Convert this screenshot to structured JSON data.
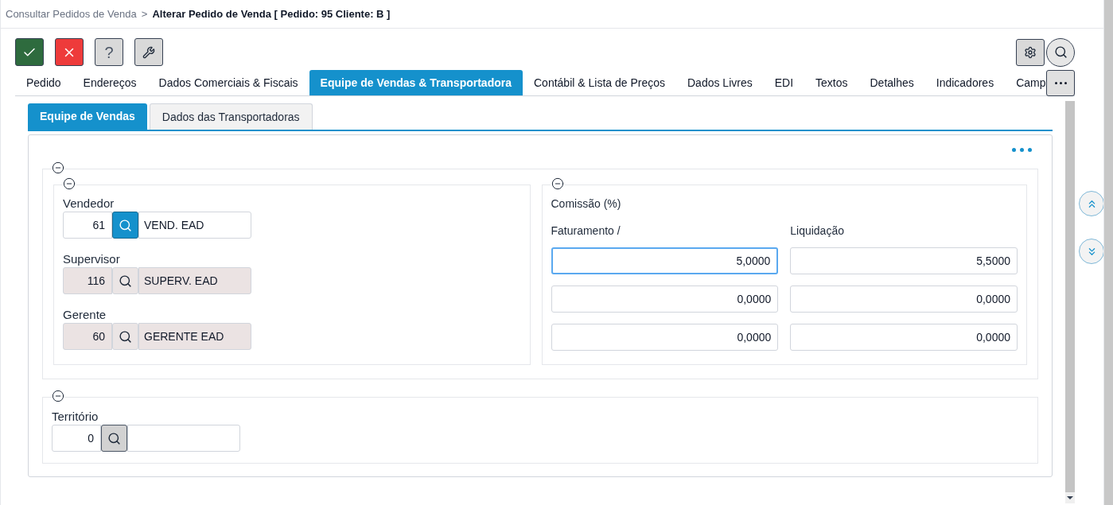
{
  "breadcrumb": {
    "parent": "Consultar Pedidos de Venda",
    "separator": ">",
    "current": "Alterar Pedido de Venda [ Pedido: 95 Cliente: B ]"
  },
  "tabs": [
    {
      "label": "Pedido",
      "selected": false
    },
    {
      "label": "Endereços",
      "selected": false
    },
    {
      "label": "Dados Comerciais & Fiscais",
      "selected": false
    },
    {
      "label": "Equipe de Vendas & Transportadora",
      "selected": true
    },
    {
      "label": "Contábil & Lista de Preços",
      "selected": false
    },
    {
      "label": "Dados Livres",
      "selected": false
    },
    {
      "label": "EDI",
      "selected": false
    },
    {
      "label": "Textos",
      "selected": false
    },
    {
      "label": "Detalhes",
      "selected": false
    },
    {
      "label": "Indicadores",
      "selected": false
    },
    {
      "label": "Camp",
      "selected": false
    }
  ],
  "subtabs": [
    {
      "label": "Equipe de Vendas",
      "selected": true
    },
    {
      "label": "Dados das Transportadoras",
      "selected": false
    }
  ],
  "team": [
    {
      "label": "Vendedor",
      "code": "61",
      "name": "VEND. EAD",
      "disabled": false,
      "highlighted": true,
      "pressed": false
    },
    {
      "label": "Supervisor",
      "code": "116",
      "name": "SUPERV. EAD",
      "disabled": true,
      "highlighted": false,
      "pressed": false
    },
    {
      "label": "Gerente",
      "code": "60",
      "name": "GERENTE EAD",
      "disabled": true,
      "highlighted": false,
      "pressed": false
    }
  ],
  "commission": {
    "title": "Comissão (%)",
    "columns": [
      "Faturamento /",
      "Liquidação"
    ],
    "rows": [
      [
        {
          "value": "5,0000",
          "focused": true
        },
        {
          "value": "5,5000",
          "focused": false
        }
      ],
      [
        {
          "value": "0,0000",
          "focused": false
        },
        {
          "value": "0,0000",
          "focused": false
        }
      ],
      [
        {
          "value": "0,0000",
          "focused": false
        },
        {
          "value": "0,0000",
          "focused": false
        }
      ]
    ]
  },
  "territory": {
    "label": "Território",
    "code": "0",
    "disabled": false,
    "highlighted": false,
    "pressed": true
  },
  "toolbar": {
    "help_label": "?"
  }
}
